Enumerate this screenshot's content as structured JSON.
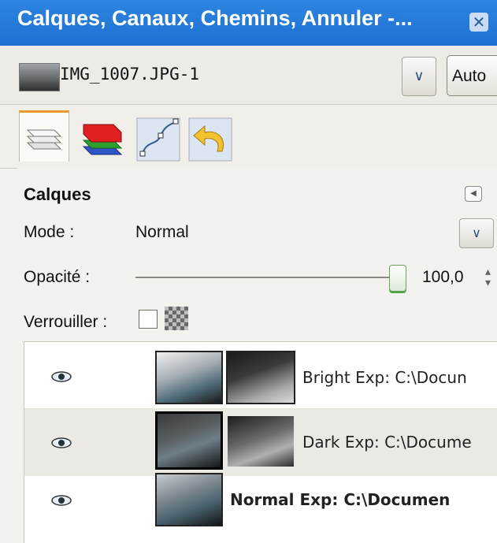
{
  "window": {
    "title": "Calques, Canaux, Chemins, Annuler -...",
    "close_icon": "close-icon"
  },
  "image_selector": {
    "name": "IMG_1007.JPG-1",
    "auto_label": "Auto"
  },
  "tabs": [
    {
      "name": "layers-tab",
      "icon": "layers-icon"
    },
    {
      "name": "channels-tab",
      "icon": "channels-icon"
    },
    {
      "name": "paths-tab",
      "icon": "paths-icon"
    },
    {
      "name": "undo-history-tab",
      "icon": "undo-icon"
    }
  ],
  "layers_panel": {
    "heading": "Calques",
    "mode_label": "Mode :",
    "mode_value": "Normal",
    "opacity_label": "Opacité :",
    "opacity_value": "100,0",
    "opacity_fraction": 1.0,
    "lock_label": "Verrouiller :"
  },
  "layers": [
    {
      "name": "Bright Exp: C:\\Docun",
      "visible": true,
      "has_mask": true,
      "bold": false
    },
    {
      "name": "Dark Exp: C:\\Docume",
      "visible": true,
      "has_mask": true,
      "bold": false
    },
    {
      "name": "Normal Exp: C:\\Documen",
      "visible": true,
      "has_mask": false,
      "bold": true
    }
  ],
  "colors": {
    "titlebar": "#1d6fd1",
    "accent_tab": "#e89b2a",
    "slider_green": "#4aa53a"
  }
}
